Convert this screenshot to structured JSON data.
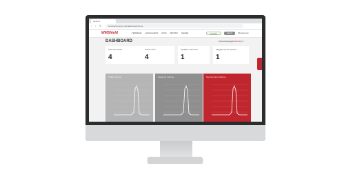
{
  "browser": {
    "tab_title": "webmin",
    "url": "wmshield.ravsys.net/dashboard/home",
    "nav": [
      "‹",
      "›",
      "↻"
    ]
  },
  "app": {
    "logo": "WMShield",
    "menu": [
      "TERMINAL",
      "ESCALADOS",
      "DATA",
      "METRIC",
      "SHARE"
    ],
    "lang_button": "English",
    "user_button": "Admin",
    "user_link": "My Account"
  },
  "dashboard": {
    "title": "DASHBOARD",
    "period_label": "Period Averaged",
    "period_value": "Monthly",
    "cards": [
      {
        "label": "Total Terminals",
        "value": "4"
      },
      {
        "label": "Online Now",
        "value": "4"
      },
      {
        "label": "Updated Last Hour",
        "value": "1"
      },
      {
        "label": "Flagged by the System",
        "value": "1"
      }
    ],
    "charts": [
      {
        "title": "Traffic Volume",
        "color": "#b5b5b5"
      },
      {
        "title": "Sessions Volume",
        "color": "#8f8f8f"
      },
      {
        "title": "Security Alert Volume",
        "color": "#c0262d"
      }
    ]
  }
}
